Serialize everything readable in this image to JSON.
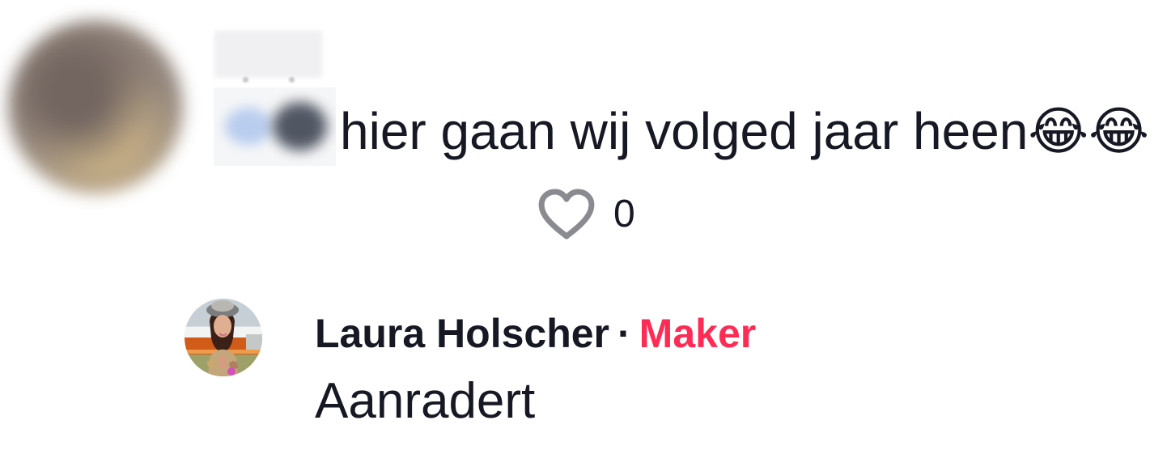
{
  "comment": {
    "text": "hier gaan wij volged jaar heen😂😂",
    "likes": "0"
  },
  "reply": {
    "author": "Laura Holscher",
    "separator": "·",
    "badge": "Maker",
    "text": "Aanradert"
  },
  "icons": {
    "like": "heart-icon"
  },
  "colors": {
    "text": "#161823",
    "badge": "#fe2c55",
    "icon": "#8a8b91"
  }
}
